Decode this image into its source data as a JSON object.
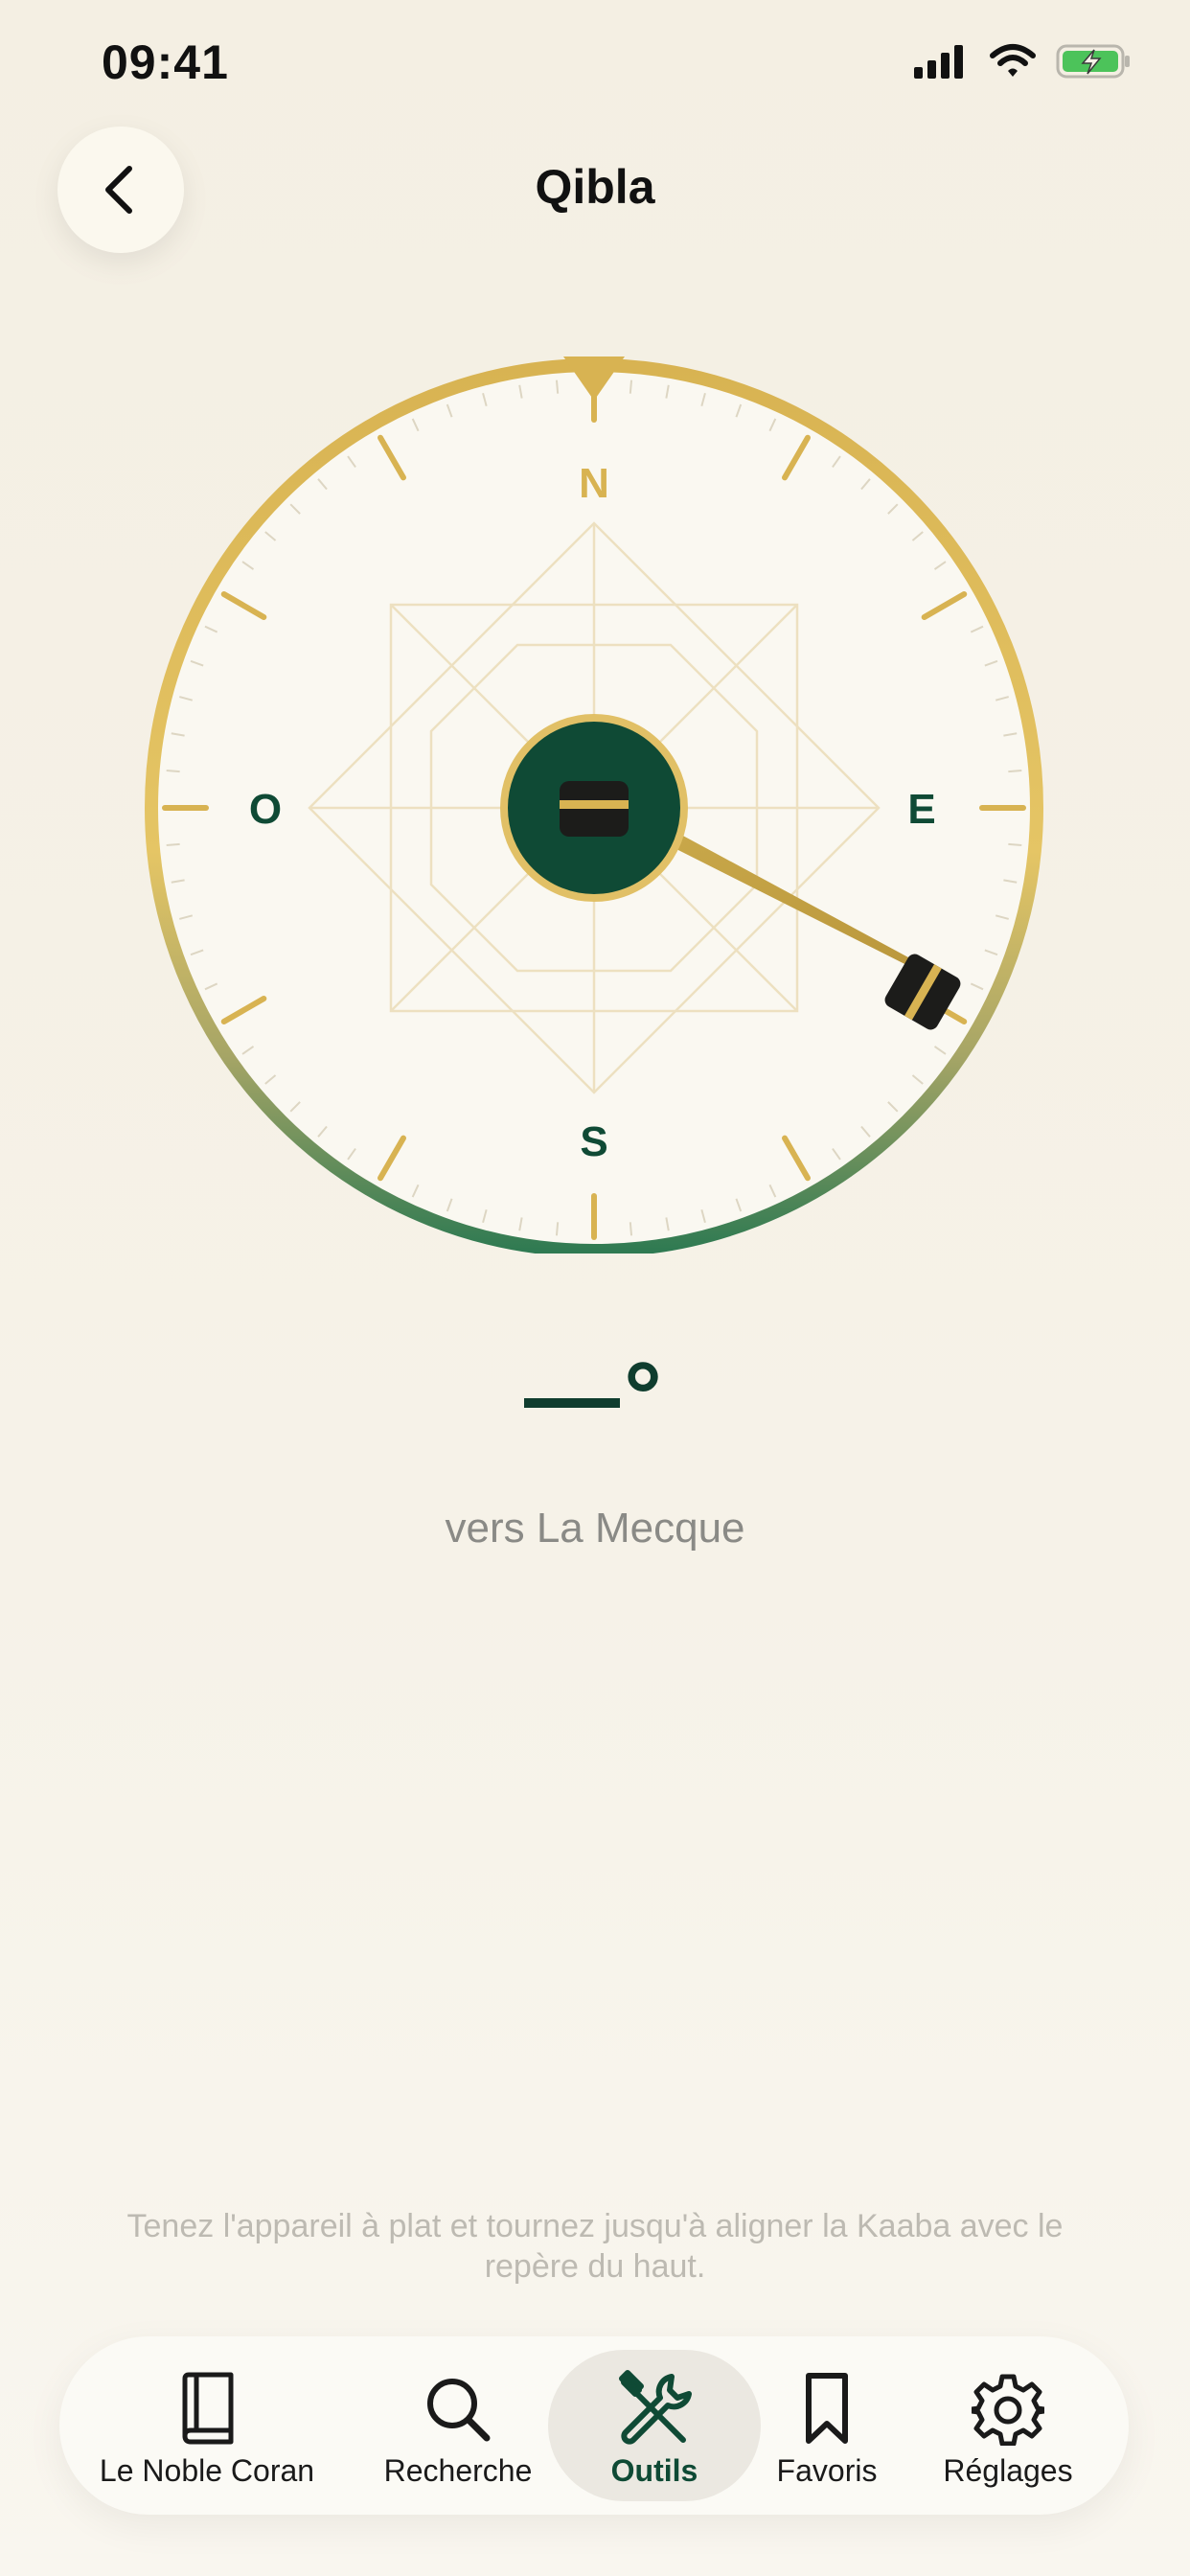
{
  "status_bar": {
    "time": "09:41",
    "icons": [
      "signal-icon",
      "wifi-icon",
      "battery-charging-icon"
    ]
  },
  "header": {
    "title": "Qibla",
    "back_icon": "chevron-left-icon"
  },
  "compass": {
    "labels": {
      "north": "N",
      "east": "E",
      "south": "S",
      "west": "O"
    },
    "colors": {
      "gold": "#d8b352",
      "green": "#0f4a35",
      "ring_bottom": "#2f7a52",
      "face": "#faf8f1"
    },
    "center_icon": "kaaba-icon",
    "pointer_icon": "kaaba-icon"
  },
  "heading": {
    "value": "—°"
  },
  "destination": "vers La Mecque",
  "hint": "Tenez l'appareil à plat et tournez jusqu'à aligner la Kaaba avec le repère du haut.",
  "tab_bar": {
    "items": [
      {
        "label": "Le Noble Coran",
        "icon": "book-icon",
        "active": false
      },
      {
        "label": "Recherche",
        "icon": "search-icon",
        "active": false
      },
      {
        "label": "Outils",
        "icon": "tools-icon",
        "active": true
      },
      {
        "label": "Favoris",
        "icon": "bookmark-icon",
        "active": false
      },
      {
        "label": "Réglages",
        "icon": "gear-icon",
        "active": false
      }
    ]
  }
}
